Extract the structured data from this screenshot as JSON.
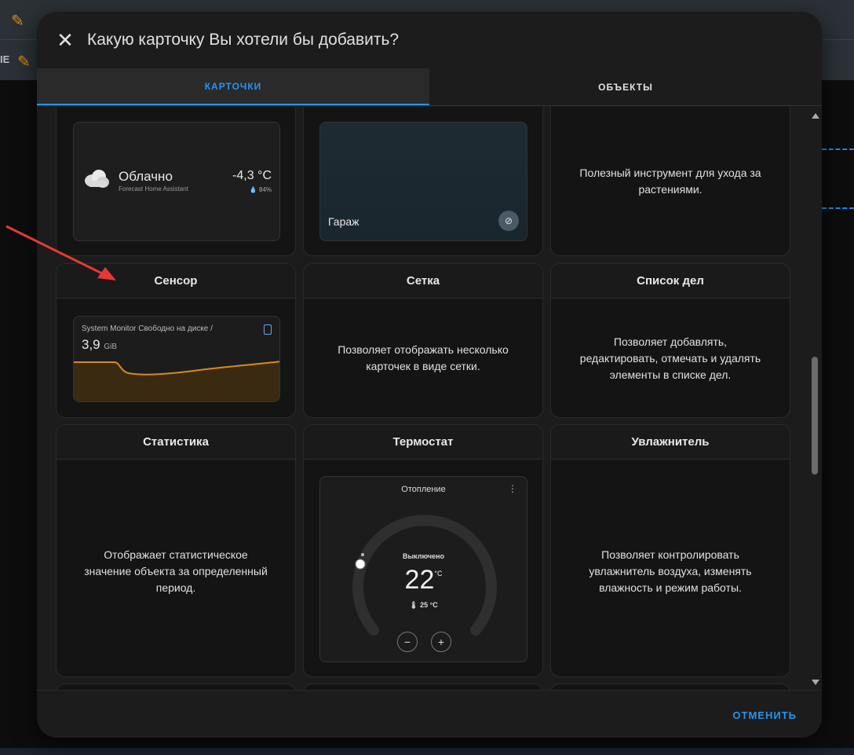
{
  "background": {
    "left_label": "IE"
  },
  "dialog": {
    "title": "Какую карточку Вы хотели бы добавить?",
    "tabs": [
      {
        "label": "КАРТОЧКИ",
        "active": true
      },
      {
        "label": "ОБЪЕКТЫ",
        "active": false
      }
    ],
    "cancel_label": "ОТМЕНИТЬ"
  },
  "cards": {
    "weather": {
      "condition": "Облачно",
      "source": "Forecast Home Assistant",
      "temperature": "-4,3 °C",
      "humidity": "84%"
    },
    "picture": {
      "label": "Гараж"
    },
    "plant": {
      "description": "Полезный инструмент для ухода за растениями."
    },
    "sensor": {
      "title": "Сенсор",
      "name": "System Monitor Свободно на диске /",
      "value": "3,9",
      "unit": "GiB"
    },
    "grid": {
      "title": "Сетка",
      "description": "Позволяет отображать несколько карточек в виде сетки."
    },
    "todo": {
      "title": "Список дел",
      "description": "Позволяет добавлять, редактировать, отмечать и удалять элементы в списке дел."
    },
    "statistic": {
      "title": "Статистика",
      "description": "Отображает статистическое значение объекта за определенный период."
    },
    "thermostat": {
      "title": "Термостат",
      "name": "Отопление",
      "state": "Выключено",
      "target": "22",
      "target_unit": "°C",
      "current": "25 °C",
      "minus": "−",
      "plus": "+"
    },
    "humidifier": {
      "title": "Увлажнитель",
      "description": "Позволяет контролировать увлажнитель воздуха, изменять влажность и режим работы."
    }
  },
  "colors": {
    "accent": "#2196f3",
    "sensor_line": "#d98a1a",
    "arrow": "#e53935"
  }
}
